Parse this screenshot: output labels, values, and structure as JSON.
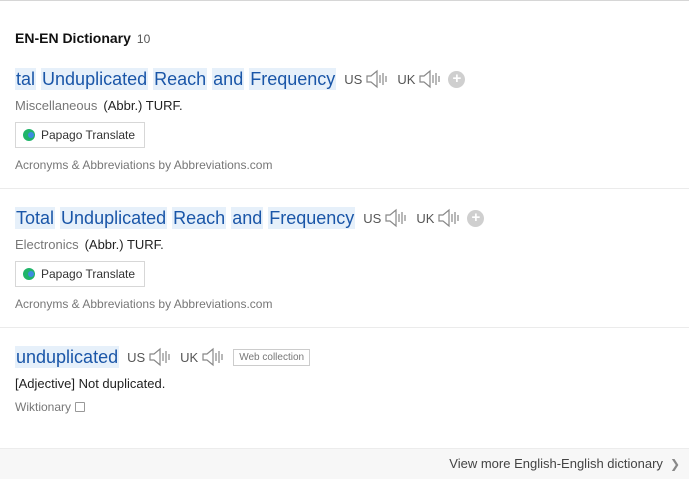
{
  "header": {
    "title": "EN-EN Dictionary",
    "count": "10"
  },
  "entries": [
    {
      "term_parts": [
        "tal",
        "Unduplicated",
        "Reach",
        "and",
        "Frequency"
      ],
      "us": "US",
      "uk": "UK",
      "category": "Miscellaneous",
      "definition": "(Abbr.) TURF.",
      "translate_label": "Papago Translate",
      "source": "Acronyms & Abbreviations by Abbreviations.com"
    },
    {
      "term_parts": [
        "Total",
        "Unduplicated",
        "Reach",
        "and",
        "Frequency"
      ],
      "us": "US",
      "uk": "UK",
      "category": "Electronics",
      "definition": "(Abbr.) TURF.",
      "translate_label": "Papago Translate",
      "source": "Acronyms & Abbreviations by Abbreviations.com"
    },
    {
      "term": "unduplicated",
      "us": "US",
      "uk": "UK",
      "badge": "Web collection",
      "definition": "[Adjective] Not duplicated.",
      "source": "Wiktionary"
    }
  ],
  "footer": {
    "more_label": "View more English-English dictionary"
  },
  "colors": {
    "term": "#1a56a8",
    "highlight": "#e6f0fa"
  }
}
